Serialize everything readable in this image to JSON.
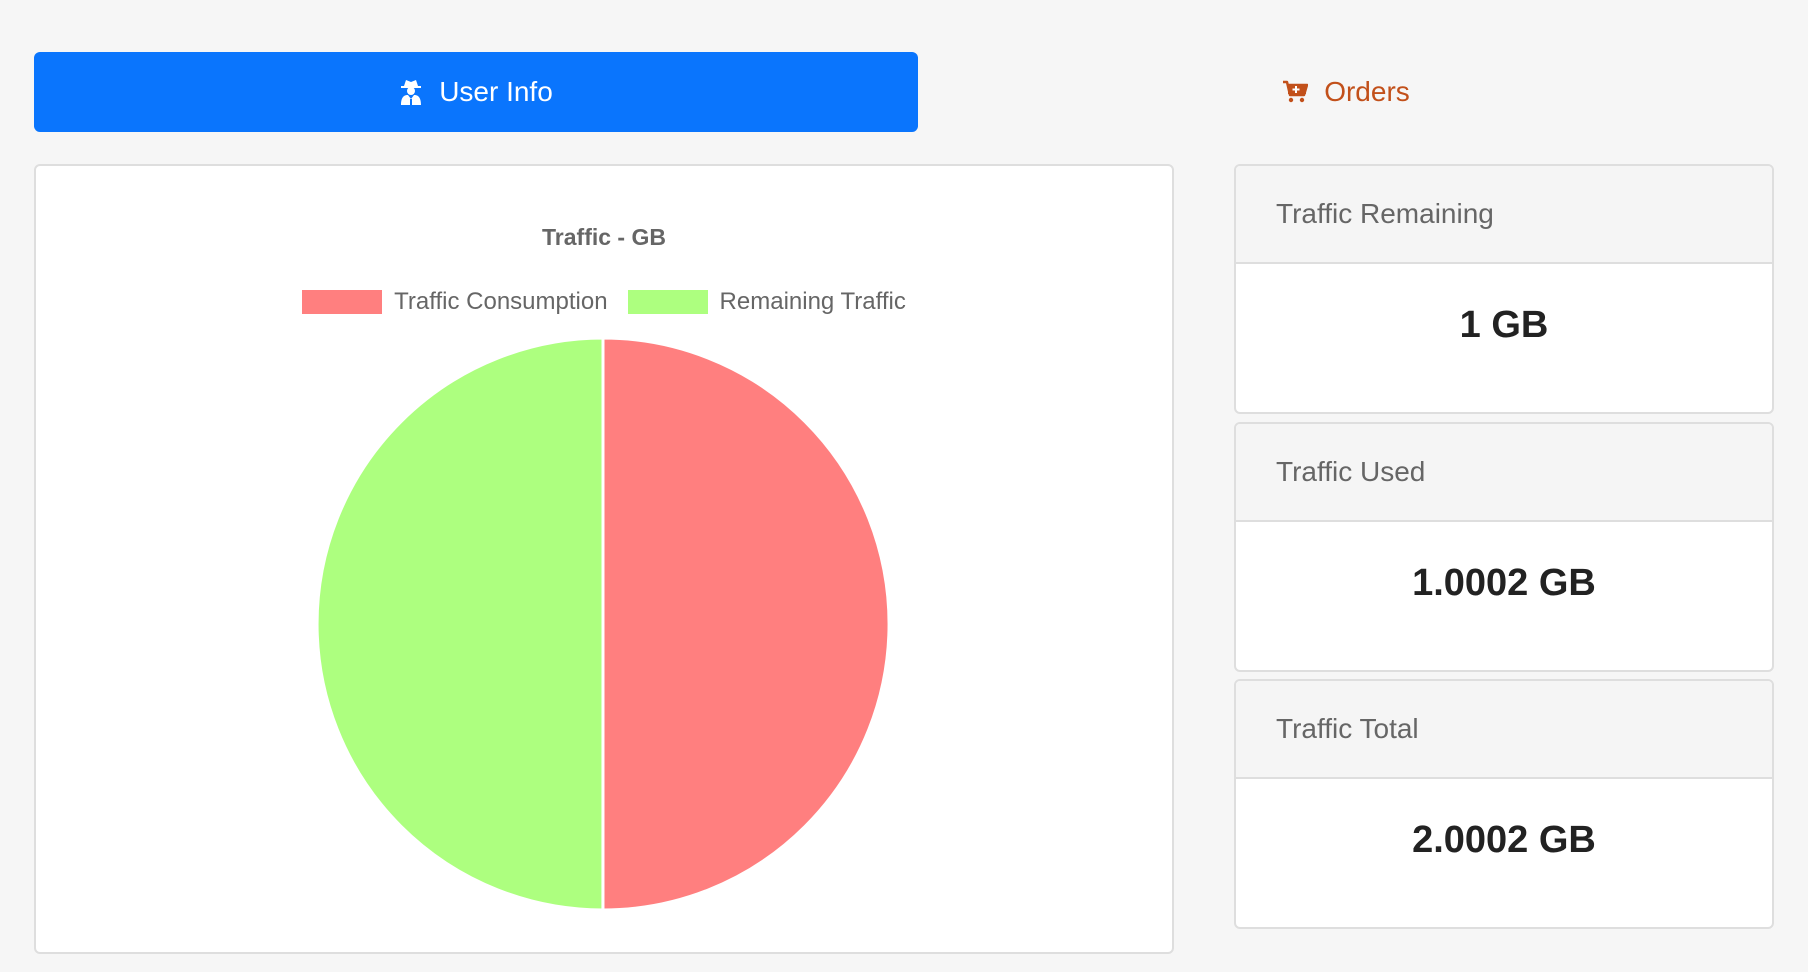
{
  "tabs": [
    {
      "label": "User Info",
      "icon": "user-secret-icon",
      "active": true
    },
    {
      "label": "Orders",
      "icon": "cart-plus-icon",
      "active": false
    }
  ],
  "colors": {
    "accent": "#0a75fd",
    "orders": "#c2501a",
    "consumption": "#ff7f7f",
    "remaining": "#adff7f"
  },
  "chart_data": {
    "type": "pie",
    "title": "Traffic - GB",
    "legend_position": "top",
    "series": [
      {
        "name": "Traffic Consumption",
        "value": 1.0002,
        "color": "#ff7f7f"
      },
      {
        "name": "Remaining Traffic",
        "value": 1,
        "color": "#adff7f"
      }
    ]
  },
  "stats": {
    "remaining": {
      "label": "Traffic Remaining",
      "value": "1 GB"
    },
    "used": {
      "label": "Traffic Used",
      "value": "1.0002 GB"
    },
    "total": {
      "label": "Traffic Total",
      "value": "2.0002 GB"
    }
  }
}
